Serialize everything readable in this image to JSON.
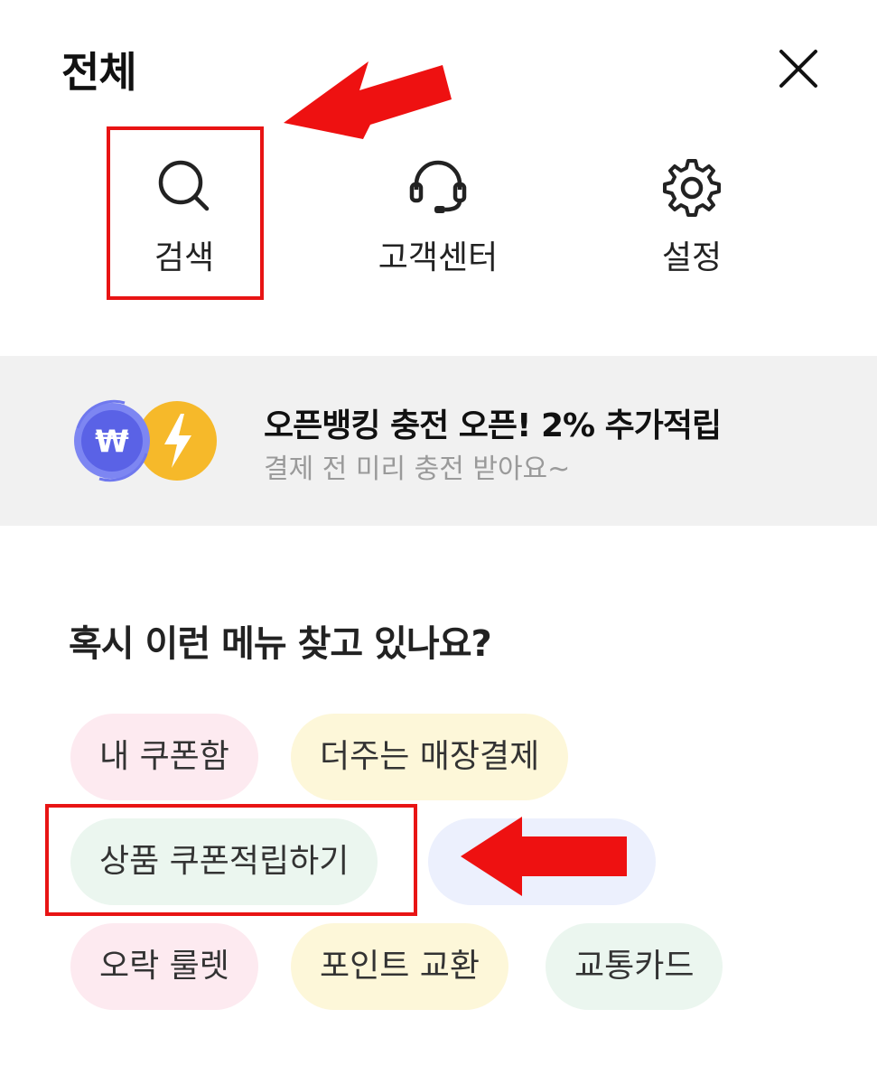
{
  "header": {
    "title": "전체"
  },
  "quick_actions": [
    {
      "label": "검색",
      "icon": "search-icon"
    },
    {
      "label": "고객센터",
      "icon": "headset-icon"
    },
    {
      "label": "설정",
      "icon": "gear-icon"
    }
  ],
  "banner": {
    "title": "오픈뱅킹 충전 오픈! 2% 추가적립",
    "subtitle": "결제 전 미리 충전 받아요~",
    "icon": "won-lightning-icon",
    "icon_symbols": {
      "won": "₩"
    }
  },
  "suggestions": {
    "title": "혹시 이런 메뉴 찾고 있나요?",
    "chips": [
      {
        "label": "내 쿠폰함",
        "color": "pink"
      },
      {
        "label": "더주는 매장결제",
        "color": "yellow"
      },
      {
        "label": "상품 쿠폰적립하기",
        "color": "green"
      },
      {
        "label": "",
        "color": "blue"
      },
      {
        "label": "오락 룰렛",
        "color": "pink"
      },
      {
        "label": "포인트 교환",
        "color": "yellow"
      },
      {
        "label": "교통카드",
        "color": "green"
      }
    ]
  },
  "annotations": {
    "highlight_color": "#e81414"
  }
}
